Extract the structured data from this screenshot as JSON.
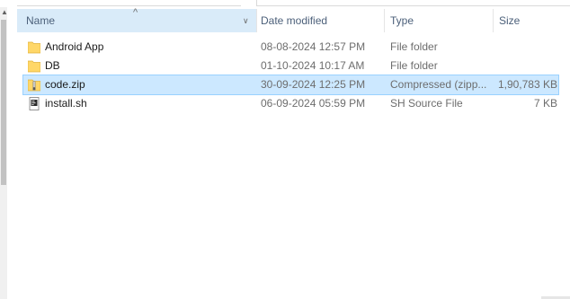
{
  "columns": {
    "name": "Name",
    "date_modified": "Date modified",
    "type": "Type",
    "size": "Size"
  },
  "files": [
    {
      "name": "Android App",
      "date": "08-08-2024 12:57 PM",
      "type": "File folder",
      "size": "",
      "icon": "folder-icon",
      "selected": false
    },
    {
      "name": "DB",
      "date": "01-10-2024 10:17 AM",
      "type": "File folder",
      "size": "",
      "icon": "folder-icon",
      "selected": false
    },
    {
      "name": "code.zip",
      "date": "30-09-2024 12:25 PM",
      "type": "Compressed (zipp...",
      "size": "1,90,783 KB",
      "icon": "zip-folder-icon",
      "selected": true
    },
    {
      "name": "install.sh",
      "date": "06-09-2024 05:59 PM",
      "type": "SH Source File",
      "size": "7 KB",
      "icon": "script-file-icon",
      "selected": false
    }
  ],
  "colors": {
    "header_hover": "#d9ebf9",
    "selection_fill": "#cce8ff",
    "selection_border": "#99d1ff",
    "folder": "#ffd768"
  }
}
